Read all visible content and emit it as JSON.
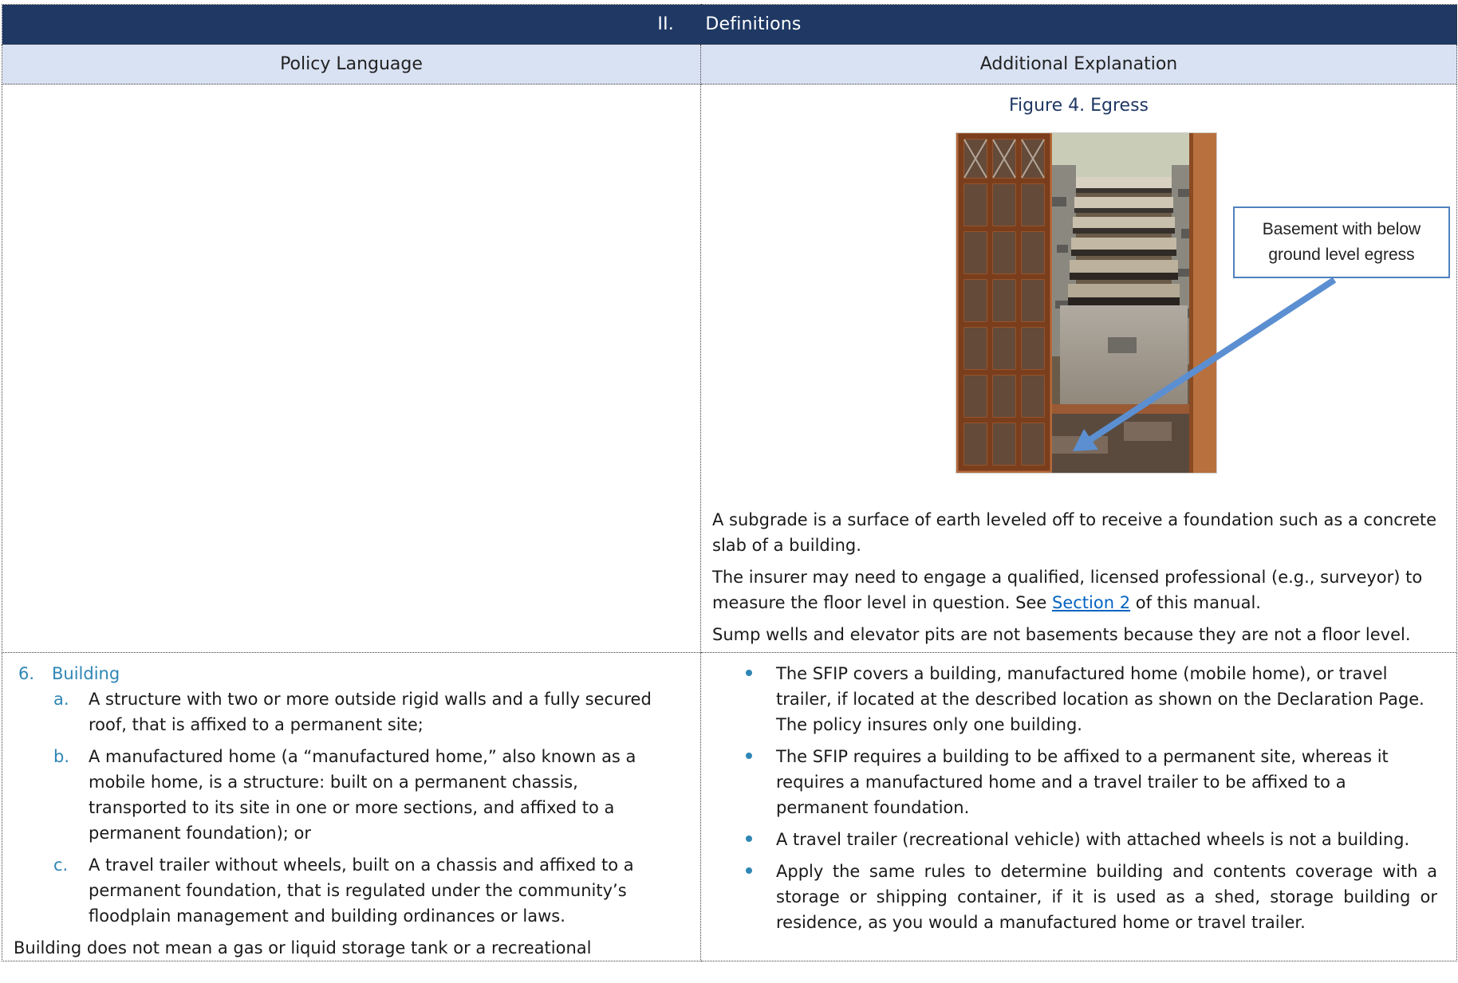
{
  "section": {
    "number": "II.",
    "title": "Definitions"
  },
  "columns": {
    "left": "Policy Language",
    "right": "Additional Explanation"
  },
  "figure": {
    "title": "Figure 4. Egress",
    "callout": "Basement with below ground level egress"
  },
  "explanation": {
    "para1": "A subgrade is a surface of earth leveled off to receive a foundation such as a concrete slab of a building.",
    "para2_before": "The insurer may need to engage a qualified, licensed professional (e.g., surveyor) to measure the floor level in question. See ",
    "para2_link": "Section 2",
    "para2_after": " of this manual.",
    "para3": "Sump wells and elevator pits are not basements because they are not a floor level."
  },
  "policy_item": {
    "number": "6.",
    "title": "Building",
    "subitems": [
      {
        "letter": "a.",
        "text": "A structure with two or more outside rigid walls and a fully secured roof, that is affixed to a permanent site;"
      },
      {
        "letter": "b.",
        "text": "A manufactured home (a “manufactured home,” also known as a mobile home, is a structure: built on a permanent chassis, transported to its site in one or more sections, and affixed to a permanent foundation); or"
      },
      {
        "letter": "c.",
        "text": "A travel trailer without wheels, built on a chassis and affixed to a permanent foundation, that is regulated under the community’s floodplain management and building ordinances or laws."
      }
    ],
    "tail": "Building does not mean a gas or liquid storage tank or a recreational"
  },
  "bullets": [
    "The SFIP covers a building, manufactured home (mobile home), or travel trailer, if located at the described location as shown on the Declaration Page. The policy insures only one building.",
    "The SFIP requires a building to be affixed to a permanent site, whereas it requires a manufactured home and a travel trailer to be affixed to a permanent foundation.",
    "A travel trailer (recreational vehicle) with attached wheels is not a building.",
    "Apply the same rules to determine building and contents coverage with a storage or shipping container, if it is used as a shed, storage building or residence, as you would a manufactured home or travel trailer."
  ],
  "colors": {
    "header_navy": "#1f3864",
    "column_header_blue": "#d9e2f3",
    "accent_teal": "#2e86b5",
    "callout_border": "#4f81bd",
    "link": "#0563c1"
  }
}
